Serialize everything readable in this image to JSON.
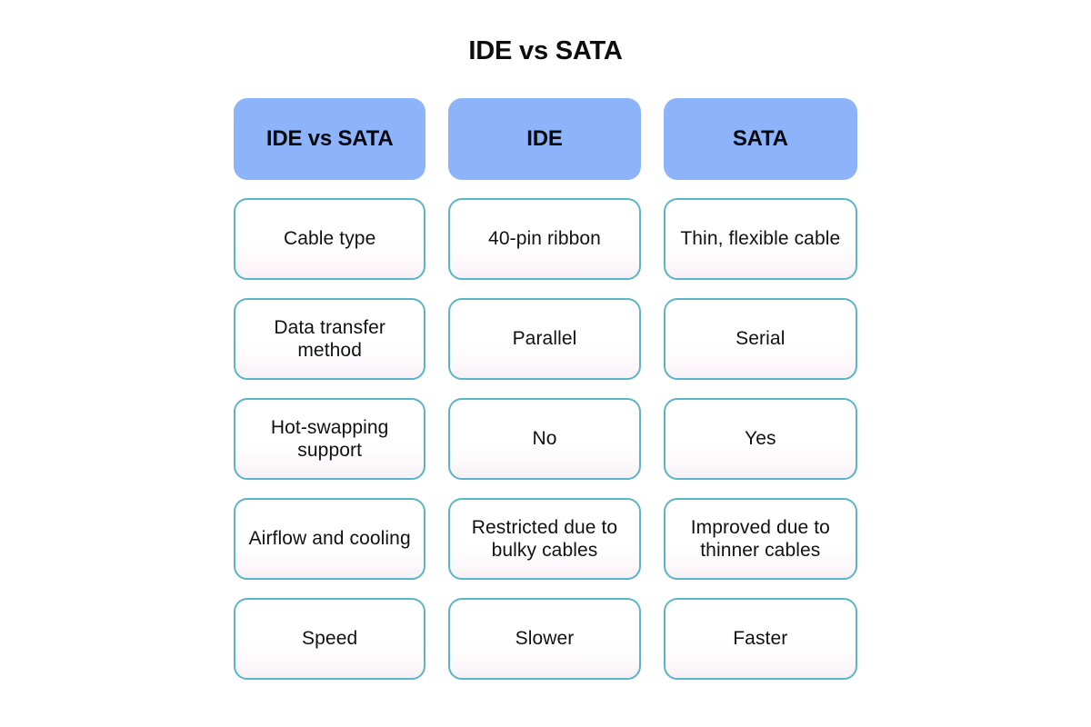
{
  "title": "IDE vs SATA",
  "table": {
    "headers": [
      {
        "label": "IDE vs SATA"
      },
      {
        "label": "IDE"
      },
      {
        "label": "SATA"
      }
    ],
    "rows": [
      {
        "feature": "Cable type",
        "ide": "40-pin ribbon",
        "sata": "Thin, flexible cable"
      },
      {
        "feature": "Data transfer method",
        "ide": "Parallel",
        "sata": "Serial"
      },
      {
        "feature": "Hot-swapping support",
        "ide": "No",
        "sata": "Yes"
      },
      {
        "feature": "Airflow and cooling",
        "ide": "Restricted due to bulky cables",
        "sata": "Improved due to thinner cables"
      },
      {
        "feature": "Speed",
        "ide": "Slower",
        "sata": "Faster"
      }
    ]
  },
  "colors": {
    "header_fill": "#8db4fb",
    "cell_border": "#5bb4c8",
    "cell_fill": "#ffffff",
    "text": "#111114",
    "background": "#ffffff"
  }
}
